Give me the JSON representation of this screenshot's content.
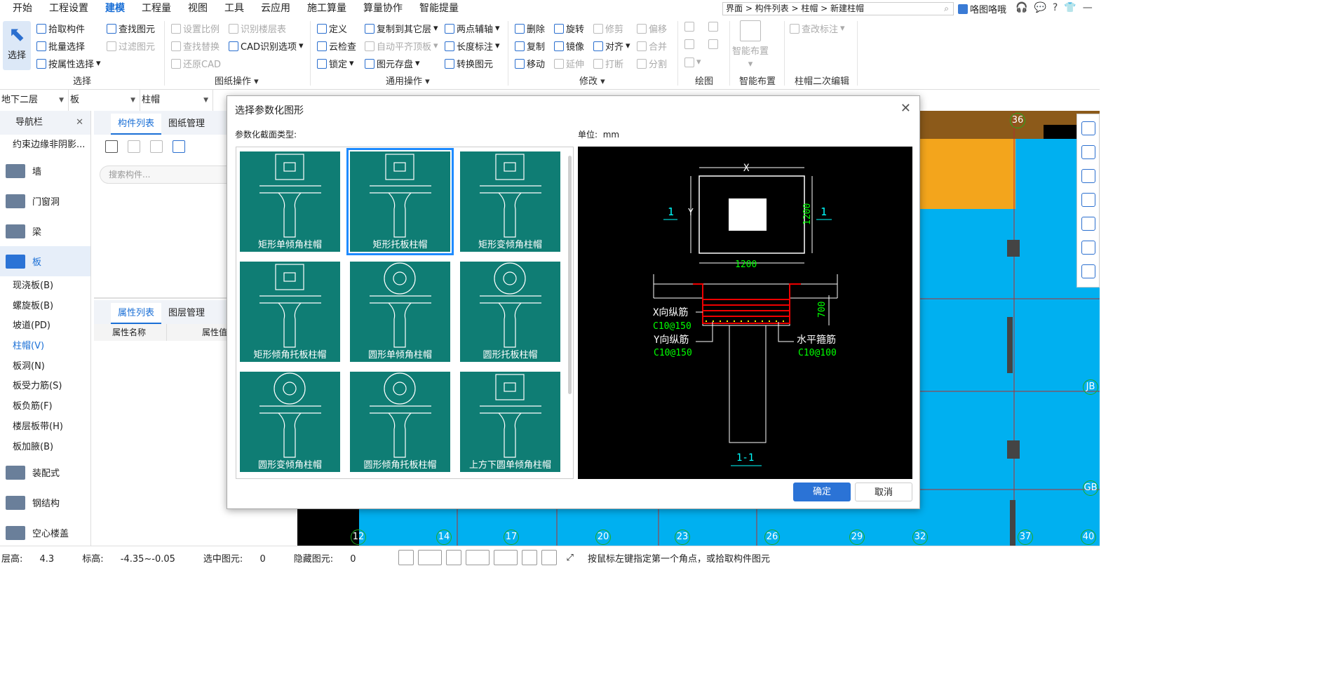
{
  "menu": {
    "items": [
      "开始",
      "工程设置",
      "建模",
      "工程量",
      "视图",
      "工具",
      "云应用",
      "施工算量",
      "算量协作",
      "智能提量"
    ],
    "active_index": 2
  },
  "breadcrumb": "界面 > 构件列表 > 柱帽 > 新建柱帽",
  "user": "咯图咯哦",
  "ribbon": {
    "select": "选择",
    "pick": "拾取构件",
    "batch": "批量选择",
    "by_attr": "按属性选择",
    "find": "查找图元",
    "filter": "过滤图元",
    "set_scale": "设置比例",
    "find_replace": "查找替换",
    "restore_cad": "还原CAD",
    "identify_layer": "识别楼层表",
    "cad_options": "CAD识别选项",
    "define": "定义",
    "cloud_check": "云检查",
    "lock": "锁定",
    "copy_floor": "复制到其它层",
    "auto_align": "自动平齐顶板",
    "save_element": "图元存盘",
    "two_point_axis": "两点辅轴",
    "length_mark": "长度标注",
    "convert": "转换图元",
    "delete": "删除",
    "copy": "复制",
    "move": "移动",
    "rotate": "旋转",
    "mirror": "镜像",
    "extend": "延伸",
    "trim": "修剪",
    "align": "对齐",
    "break": "打断",
    "offset": "偏移",
    "merge": "合并",
    "split": "分割",
    "smart_layout": "智能布置",
    "check_mark": "查改标注",
    "groups": {
      "select": "选择",
      "drawing_ops": "图纸操作",
      "general_ops": "通用操作",
      "modify": "修改",
      "draw": "绘图",
      "smart_layout": "智能布置",
      "secondary_edit": "柱帽二次编辑"
    }
  },
  "selectors": {
    "floor": "地下二层",
    "type": "板",
    "component": "柱帽"
  },
  "nav": {
    "header": "导航栏",
    "first": "约束边缘非阴影...",
    "items": [
      "墙",
      "门窗洞",
      "梁",
      "板"
    ],
    "sub": [
      "现浇板(B)",
      "螺旋板(B)",
      "坡道(PD)",
      "柱帽(V)",
      "板洞(N)",
      "板受力筋(S)",
      "板负筋(F)",
      "楼层板带(H)",
      "板加腋(B)"
    ],
    "current_sub": "柱帽(V)",
    "items2": [
      "装配式",
      "钢结构",
      "空心楼盖"
    ]
  },
  "panel": {
    "tab1": "构件列表",
    "tab2": "图纸管理",
    "search_placeholder": "搜索构件...",
    "tab3": "属性列表",
    "tab4": "图层管理",
    "col1": "属性名称",
    "col2": "属性值"
  },
  "dialog": {
    "title": "选择参数化图形",
    "section_label": "参数化截面类型:",
    "unit_label": "单位:",
    "unit": "mm",
    "ok": "确定",
    "cancel": "取消",
    "shapes": [
      "矩形单倾角柱帽",
      "矩形托板柱帽",
      "矩形变倾角柱帽",
      "矩形倾角托板柱帽",
      "圆形单倾角柱帽",
      "圆形托板柱帽",
      "圆形变倾角柱帽",
      "圆形倾角托板柱帽",
      "上方下圆单倾角柱帽"
    ],
    "selected_index": 1
  },
  "preview": {
    "x": "X",
    "y": "Y",
    "dim1": "1200",
    "dim2": "1200",
    "sec_mark": "1",
    "sec_label": "1-1",
    "h": "700",
    "x_bar": "X向纵筋",
    "x_spec": "C10@150",
    "y_bar": "Y向纵筋",
    "y_spec": "C10@150",
    "stirrup": "水平箍筋",
    "stirrup_spec": "C10@100"
  },
  "axis_labels": [
    "12",
    "14",
    "17",
    "20",
    "23",
    "26",
    "29",
    "32",
    "37",
    "40",
    "36",
    "JB",
    "GB"
  ],
  "status": {
    "floor_height_label": "层高:",
    "floor_height": "4.3",
    "elevation_label": "标高:",
    "elevation": "-4.35~-0.05",
    "selected_label": "选中图元:",
    "selected": "0",
    "hidden_label": "隐藏图元:",
    "hidden": "0",
    "hint": "按鼠标左键指定第一个角点，或拾取构件图元"
  }
}
